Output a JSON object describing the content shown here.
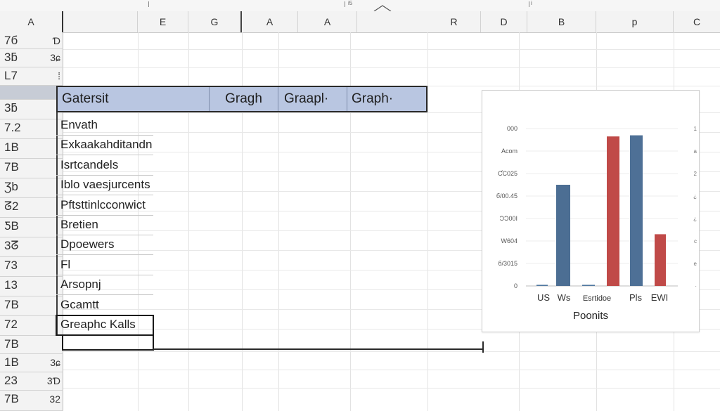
{
  "ruler": {
    "labels": [
      "|",
      "i5",
      "i"
    ]
  },
  "column_headers": [
    "A",
    "E",
    "G",
    "A",
    "A",
    "R",
    "D",
    "B",
    "p",
    "C"
  ],
  "row_headers": [
    {
      "left": "7б",
      "right": "Ɗ"
    },
    {
      "left": "3ƃ",
      "right": "3ɕ"
    },
    {
      "left": "L7",
      "right": "⁞"
    },
    {
      "left": "",
      "right": ""
    },
    {
      "left": "3ƃ",
      "right": ""
    },
    {
      "left": "7.2",
      "right": ""
    },
    {
      "left": "1B",
      "right": ""
    },
    {
      "left": "7B",
      "right": ""
    },
    {
      "left": "Ʒb",
      "right": ""
    },
    {
      "left": "ᘔ2",
      "right": ""
    },
    {
      "left": "ƼB",
      "right": ""
    },
    {
      "left": "3ᘔ",
      "right": ""
    },
    {
      "left": "73",
      "right": ""
    },
    {
      "left": "13",
      "right": ""
    },
    {
      "left": "7B",
      "right": ""
    },
    {
      "left": "72",
      "right": ""
    },
    {
      "left": "7B",
      "right": ""
    },
    {
      "left": "1B",
      "right": "3ɕ"
    },
    {
      "left": "23",
      "right": "3Ɗ"
    },
    {
      "left": "7B",
      "right": "32"
    }
  ],
  "table": {
    "headers": [
      "Gatersit",
      "Gragh",
      "Graapl·",
      "Graph·"
    ],
    "rows": [
      "Envath",
      "Exkaakahditandn",
      "Isrtcandels",
      "Iblo vaesjurcents",
      "Pftsttinlcconwict",
      "Bretien",
      "Dpoewers",
      "Fl",
      "Arsopnj",
      "Gcamtt",
      "Greaphc Kalls"
    ]
  },
  "chart_data": {
    "type": "bar",
    "title": "",
    "xlabel": "Poonits",
    "ylabel": "",
    "categories": [
      "US",
      "Ws",
      "Esrtidoe",
      "Pls",
      "EWI"
    ],
    "y_tick_labels": [
      "000",
      "Aсom",
      "ƇC025",
      "б/00.45",
      "ƆƆ00I",
      "W604",
      "б/3015",
      "0"
    ],
    "right_tick_labels": [
      "1",
      "a",
      "2",
      "¿",
      "¿",
      "c",
      "e",
      "·"
    ],
    "ylim": [
      0,
      7
    ],
    "bars": [
      {
        "category": "US",
        "value": 0.05,
        "color": "#5078a0"
      },
      {
        "category": "Ws",
        "value": 4.5,
        "color": "#4c6e93"
      },
      {
        "category": "Esrtidoe",
        "value": 0.05,
        "color": "#5078a0"
      },
      {
        "category": "Pls",
        "value": 6.65,
        "color": "#c04a48"
      },
      {
        "category": "Pls",
        "value": 6.7,
        "color": "#4e7096"
      },
      {
        "category": "EWI",
        "value": 2.3,
        "color": "#c04a48"
      }
    ],
    "colors": {
      "blue": "#4e7096",
      "red": "#c04a48"
    }
  }
}
